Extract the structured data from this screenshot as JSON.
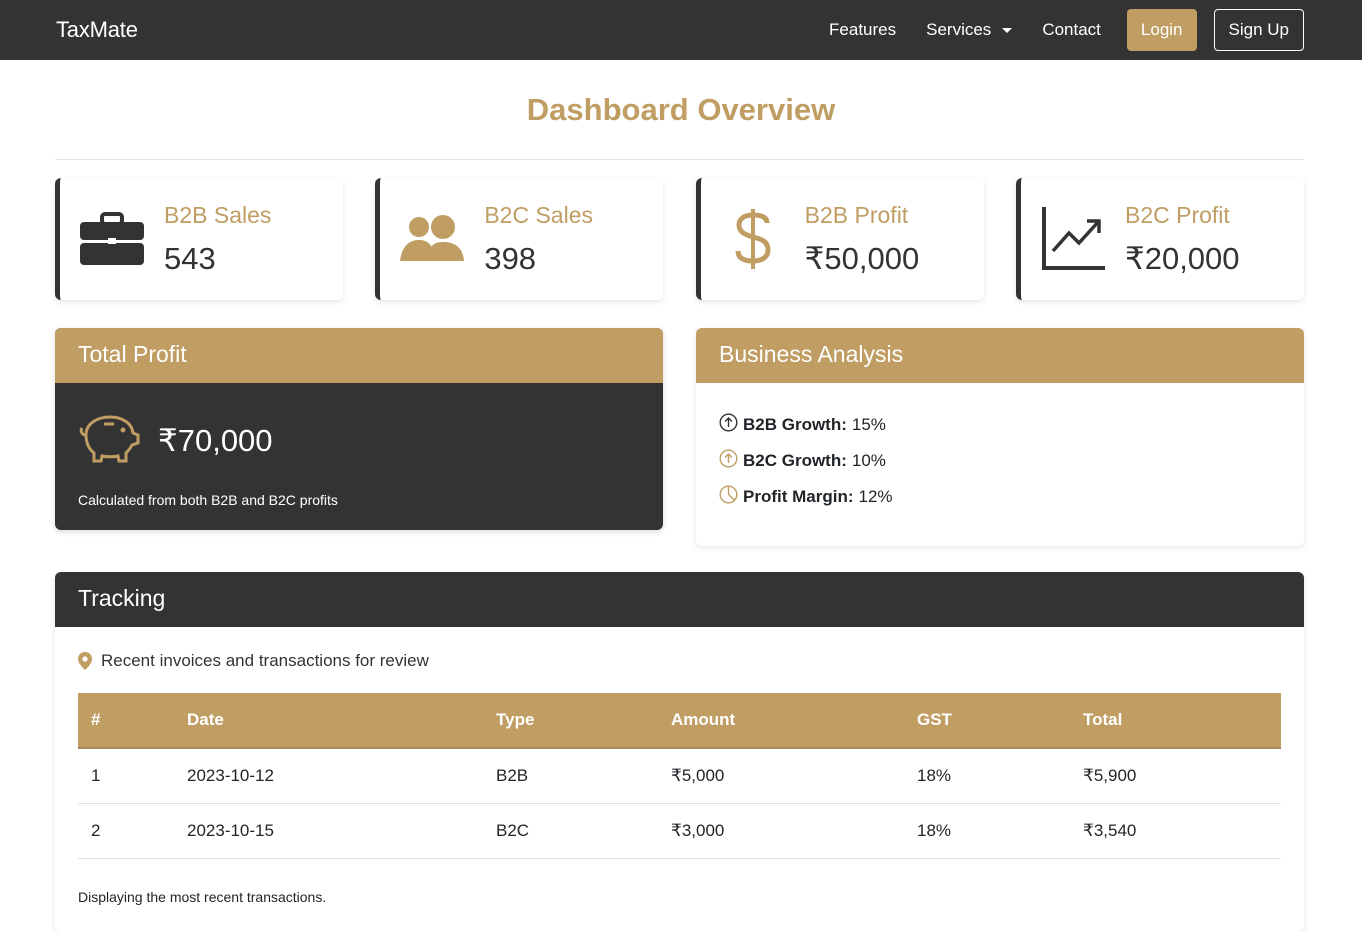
{
  "navbar": {
    "brand": "TaxMate",
    "links": [
      "Features",
      "Services",
      "Contact"
    ],
    "login": "Login",
    "signup": "Sign Up"
  },
  "title": "Dashboard Overview",
  "stats": [
    {
      "label": "B2B Sales",
      "value": "543",
      "icon": "briefcase-icon"
    },
    {
      "label": "B2C Sales",
      "value": "398",
      "icon": "people-icon"
    },
    {
      "label": "B2B Profit",
      "value": "₹50,000",
      "icon": "dollar-icon"
    },
    {
      "label": "B2C Profit",
      "value": "₹20,000",
      "icon": "graph-up-icon"
    }
  ],
  "total_profit": {
    "title": "Total Profit",
    "value": "₹70,000",
    "note": "Calculated from both B2B and B2C profits"
  },
  "analysis": {
    "title": "Business Analysis",
    "items": [
      {
        "label": "B2B Growth:",
        "value": "15%"
      },
      {
        "label": "B2C Growth:",
        "value": "10%"
      },
      {
        "label": "Profit Margin:",
        "value": "12%"
      }
    ]
  },
  "tracking": {
    "title": "Tracking",
    "description": "Recent invoices and transactions for review",
    "columns": [
      "#",
      "Date",
      "Type",
      "Amount",
      "GST",
      "Total"
    ],
    "rows": [
      [
        "1",
        "2023-10-12",
        "B2B",
        "₹5,000",
        "18%",
        "₹5,900"
      ],
      [
        "2",
        "2023-10-15",
        "B2C",
        "₹3,000",
        "18%",
        "₹3,540"
      ]
    ],
    "note": "Displaying the most recent transactions."
  },
  "colors": {
    "accent": "#c09d62",
    "dark": "#333333"
  }
}
